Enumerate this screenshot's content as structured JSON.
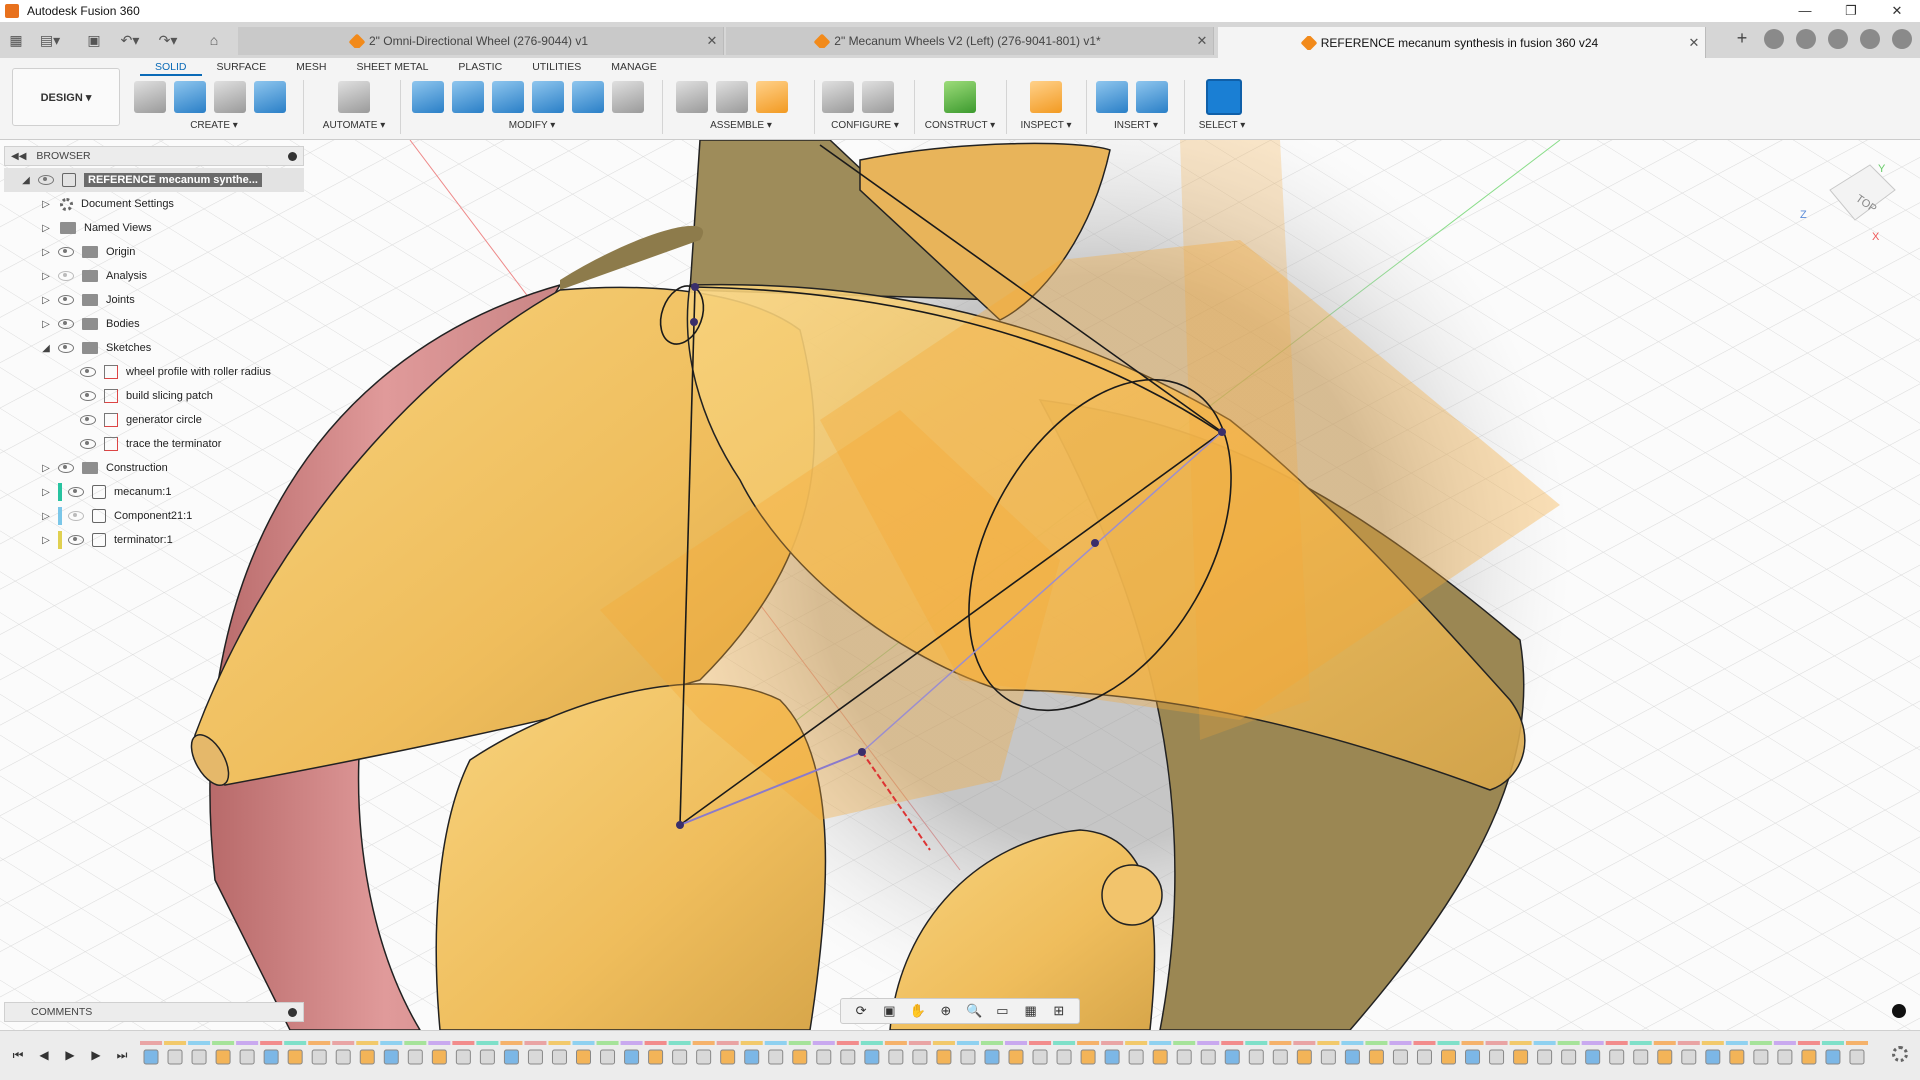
{
  "window": {
    "title": "Autodesk Fusion 360",
    "controls": [
      "—",
      "❐",
      "✕"
    ]
  },
  "tabs": [
    {
      "label": "2\" Omni-Directional Wheel (276-9044) v1",
      "active": false
    },
    {
      "label": "2\" Mecanum Wheels V2 (Left) (276-9041-801) v1*",
      "active": false
    },
    {
      "label": "REFERENCE mecanum synthesis in fusion 360 v24",
      "active": true
    }
  ],
  "ribbon": {
    "workspace": "DESIGN ▾",
    "tabs": [
      "SOLID",
      "SURFACE",
      "MESH",
      "SHEET METAL",
      "PLASTIC",
      "UTILITIES",
      "MANAGE"
    ],
    "active_tab": "SOLID",
    "groups": [
      "CREATE ▾",
      "AUTOMATE ▾",
      "MODIFY ▾",
      "ASSEMBLE ▾",
      "CONFIGURE ▾",
      "CONSTRUCT ▾",
      "INSPECT ▾",
      "INSERT ▾",
      "SELECT ▾"
    ]
  },
  "browser": {
    "title": "BROWSER",
    "root": "REFERENCE mecanum synthe...",
    "nodes": [
      {
        "label": "Document Settings"
      },
      {
        "label": "Named Views"
      },
      {
        "label": "Origin"
      },
      {
        "label": "Analysis"
      },
      {
        "label": "Joints"
      },
      {
        "label": "Bodies"
      },
      {
        "label": "Sketches"
      },
      {
        "label": "wheel profile with roller radius"
      },
      {
        "label": "build slicing patch"
      },
      {
        "label": "generator circle"
      },
      {
        "label": "trace the terminator"
      },
      {
        "label": "Construction"
      },
      {
        "label": "mecanum:1"
      },
      {
        "label": "Component21:1"
      },
      {
        "label": "terminator:1"
      }
    ]
  },
  "comments": {
    "title": "COMMENTS"
  },
  "viewcube": {
    "face": "TOP"
  },
  "colors": {
    "roller": "#f1c36a",
    "roller_shade": "#b69a5a",
    "plane": "#f6a833",
    "rim": "#d98a8a",
    "select_blue": "#1a7fd4"
  }
}
